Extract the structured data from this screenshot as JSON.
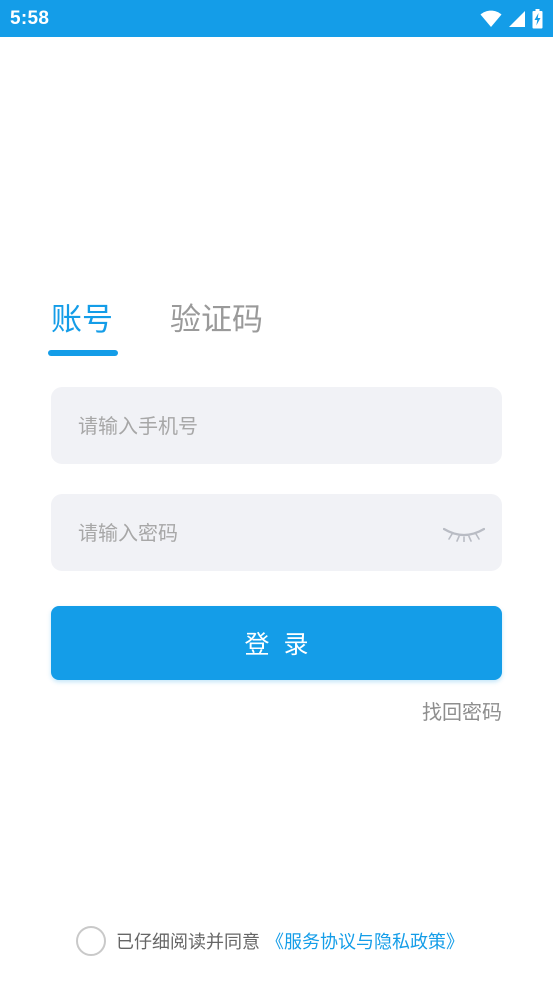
{
  "status_bar": {
    "time": "5:58",
    "icons": [
      "wifi-icon",
      "cell-signal-icon",
      "battery-charging-icon"
    ],
    "background": "#149de8"
  },
  "login": {
    "tabs": [
      {
        "label": "账号",
        "active": true
      },
      {
        "label": "验证码",
        "active": false
      }
    ],
    "phone_placeholder": "请输入手机号",
    "password_placeholder": "请输入密码",
    "password_visibility_icon": "eye-closed-icon",
    "login_button": "登录",
    "forgot_password": "找回密码"
  },
  "agreement": {
    "checked": false,
    "text": "已仔细阅读并同意",
    "link": "《服务协议与隐私政策》"
  },
  "colors": {
    "accent": "#149de8",
    "input_bg": "#f1f2f6",
    "muted_text": "#9a9a9a"
  }
}
